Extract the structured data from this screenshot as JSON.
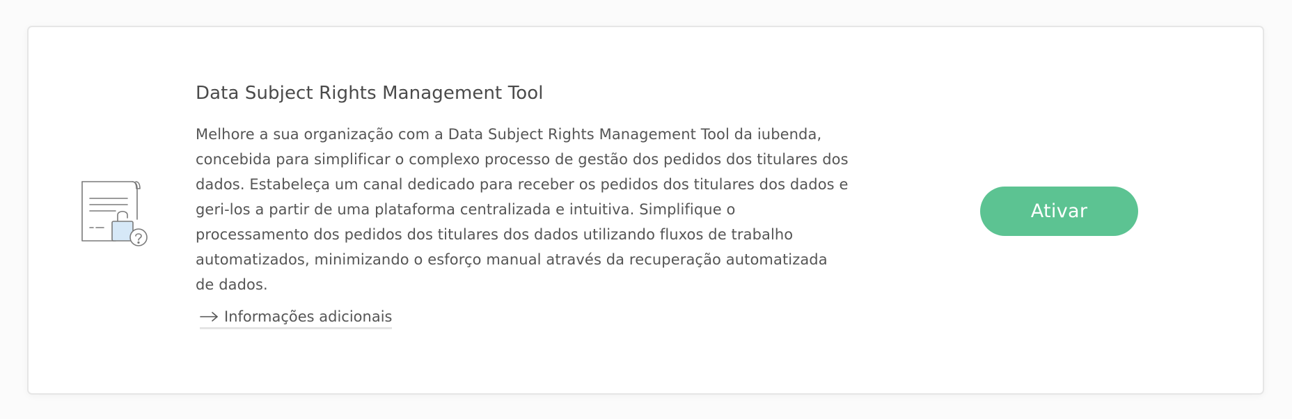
{
  "card": {
    "icon": "document-lock-question-icon",
    "title": "Data Subject Rights Management Tool",
    "description": "Melhore a sua organização com a Data Subject Rights Management Tool da iubenda, concebida para simplificar o complexo processo de gestão dos pedidos dos titulares dos dados. Estabeleça um canal dedicado para receber os pedidos dos titulares dos dados e geri-los a partir de uma plataforma centralizada e intuitiva. Simplifique o processamento dos pedidos dos titulares dos dados utilizando fluxos de trabalho automatizados, minimizando o esforço manual através da recuperação automatizada de dados.",
    "more_info": {
      "icon": "arrow-right-icon",
      "label": "Informações adicionais"
    },
    "activate_label": "Ativar"
  },
  "colors": {
    "accent": "#5cc392",
    "icon_fill": "#d6e8f7"
  }
}
